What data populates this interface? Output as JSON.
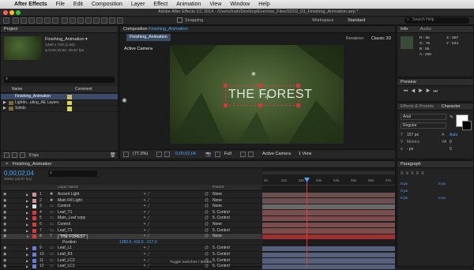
{
  "menubar": {
    "app": "After Effects",
    "items": [
      "File",
      "Edit",
      "Composition",
      "Layer",
      "Effect",
      "Animation",
      "View",
      "Window",
      "Help"
    ]
  },
  "window_title": "Adobe After Effects CC 2014 - /Users/iraih/Desktop/Exercise_Files/02/02_03_Finishing_Animation.aep *",
  "toolbar": {
    "snapping": "Snapping",
    "workspace_label": "Workspace",
    "workspace_value": "Standard",
    "search_placeholder": "Search Help"
  },
  "project": {
    "tab": "Project",
    "comp_name": "Finishing_Animation ▾",
    "comp_info1": "1280 x 720 (1.00)",
    "comp_info2": "Δ 0;00;10;00, 29.97 fps",
    "columns": [
      "Name",
      "Comment"
    ],
    "items": [
      {
        "name": "Finishing_Animation",
        "color": "#c9b86e",
        "selected": true
      },
      {
        "name": "Lightin...uting_AE Layers",
        "color": "#d8d84a"
      },
      {
        "name": "Solids",
        "color": "#d8d84a"
      }
    ],
    "bpc": "8 bpc"
  },
  "comp": {
    "tab": "Composition",
    "tab_name": "Finishing_Animation",
    "subtab": "Finishing_Animation",
    "camera": "Active Camera",
    "renderer": "Renderer:",
    "renderer_value": "Classic 3D",
    "forest_text": "THE FOREST",
    "zoom": "(77.2%)",
    "timecode": "0;00;02;04",
    "resolution": "Full",
    "view_camera": "Active Camera",
    "views": "1 View"
  },
  "info": {
    "tab": "Info",
    "audio": "Audio",
    "R": "R : 56",
    "G": "G : 76",
    "B": "B : 55",
    "A": "A : 255",
    "X": "X : 587",
    "Y": "Y : 644"
  },
  "preview": {
    "tab": "Preview"
  },
  "character": {
    "tabs": [
      "Effects & Presets",
      "Character"
    ],
    "font": "Arial",
    "style": "Regular",
    "size": "157 px",
    "tracking": "Auto",
    "val1": "0",
    "val2": "Metrics",
    "val3": "0",
    "px_label": "- px"
  },
  "paragraph": {
    "tab": "Paragraph",
    "values": [
      "0 px",
      "0 px",
      "0 px",
      "0 px",
      "0 px"
    ]
  },
  "timeline": {
    "tab": "Finishing_Animation",
    "timecode": "0;00;02;04",
    "frame_info": "00064 (29.97 fps)",
    "columns": {
      "name": "Layer Name",
      "parent": "Parent"
    },
    "ticks": [
      "0s",
      "01s",
      "02s",
      "03s",
      "04s",
      "05s",
      "06s",
      "07s"
    ],
    "layers": [
      {
        "num": "1",
        "name": "Accent Light",
        "color": "#d89090",
        "parent": "None",
        "kind": "light"
      },
      {
        "num": "2",
        "name": "Main Fill Light",
        "color": "#d89090",
        "parent": "None",
        "kind": "light"
      },
      {
        "num": "3",
        "name": "Control",
        "color": "#e0e0e0",
        "parent": "None",
        "kind": "null"
      },
      {
        "num": "4",
        "name": "Leaf_T1",
        "color": "#d83a3a",
        "parent": "5. Control",
        "kind": "layer"
      },
      {
        "num": "5",
        "name": "Main_Leaf copy",
        "color": "#d83a3a",
        "parent": "5. Control",
        "kind": "layer"
      },
      {
        "num": "6",
        "name": "Control",
        "color": "#d83a3a",
        "parent": "None",
        "kind": "layer"
      },
      {
        "num": "7",
        "name": "Leaf_T1",
        "color": "#d83a3a",
        "parent": "5. Control",
        "kind": "layer"
      },
      {
        "num": "8",
        "name": "THE FOREST",
        "color": "#d83a3a",
        "parent": "None",
        "kind": "text",
        "selected": true
      },
      {
        "num": "",
        "name": "Position",
        "color": "",
        "parent": "",
        "kind": "prop",
        "value": "1280.0, 416.0, -217.0"
      },
      {
        "num": "9",
        "name": "Leaf_L1",
        "color": "#6a7fd8",
        "parent": "5. Control",
        "kind": "layer"
      },
      {
        "num": "10",
        "name": "Leaf_R1",
        "color": "#6a7fd8",
        "parent": "5. Control",
        "kind": "layer"
      },
      {
        "num": "11",
        "name": "Leaf_LC2",
        "color": "#6a7fd8",
        "parent": "5. Control",
        "kind": "layer"
      },
      {
        "num": "12",
        "name": "Leaf_LC1",
        "color": "#6a7fd8",
        "parent": "5. Control",
        "kind": "layer"
      }
    ],
    "toggle": "Toggle Switches / Modes"
  }
}
